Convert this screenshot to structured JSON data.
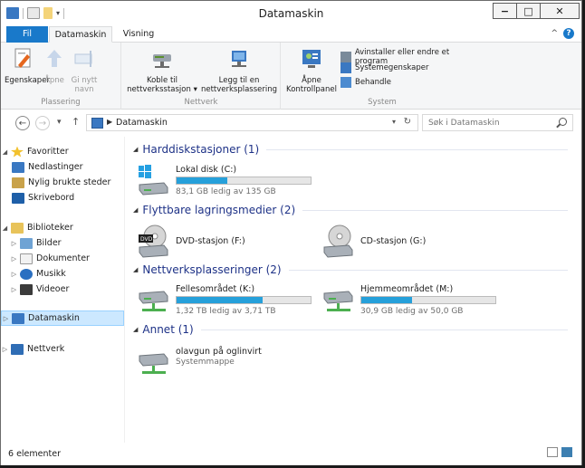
{
  "window": {
    "title": "Datamaskin"
  },
  "title_buttons": {
    "minimize": "−",
    "maximize": "□",
    "close": "✕"
  },
  "tabs": {
    "file": "Fil",
    "computer": "Datamaskin",
    "view": "Visning"
  },
  "ribbon": {
    "location": {
      "label": "Plassering",
      "properties": "Egenskaper",
      "open": "Åpne",
      "rename_1": "Gi nytt",
      "rename_2": "navn"
    },
    "network": {
      "label": "Nettverk",
      "map_drive_1": "Koble til",
      "map_drive_2": "nettverksstasjon ▾",
      "add_location_1": "Legg til en",
      "add_location_2": "nettverksplassering"
    },
    "system": {
      "label": "System",
      "control_panel_1": "Åpne",
      "control_panel_2": "Kontrollpanel",
      "uninstall": "Avinstaller eller endre et program",
      "sysprops": "Systemegenskaper",
      "manage": "Behandle"
    }
  },
  "address": {
    "path": "Datamaskin",
    "search_placeholder": "Søk i Datamaskin"
  },
  "navpane": {
    "favorites": "Favoritter",
    "downloads": "Nedlastinger",
    "recent": "Nylig brukte steder",
    "desktop": "Skrivebord",
    "libraries": "Biblioteker",
    "pictures": "Bilder",
    "documents": "Dokumenter",
    "music": "Musikk",
    "videos": "Videoer",
    "computer": "Datamaskin",
    "network": "Nettverk"
  },
  "groups": {
    "hdd": "Harddiskstasjoner (1)",
    "removable": "Flyttbare lagringsmedier (2)",
    "network": "Nettverksplasseringer (2)",
    "other": "Annet (1)"
  },
  "drives": {
    "c": {
      "name": "Lokal disk (C:)",
      "free": "83,1 GB ledig av 135 GB",
      "used_fraction": 0.38
    },
    "f": {
      "name": "DVD-stasjon (F:)"
    },
    "g": {
      "name": "CD-stasjon (G:)"
    },
    "k": {
      "name": "Fellesområdet (K:)",
      "free": "1,32 TB ledig av 3,71 TB",
      "used_fraction": 0.64
    },
    "m": {
      "name": "Hjemmeområdet (M:)",
      "free": "30,9 GB ledig av 50,0 GB",
      "used_fraction": 0.38
    },
    "olav": {
      "name": "olavgun på oglinvirt",
      "type": "Systemmappe"
    }
  },
  "status": {
    "count": "6 elementer"
  },
  "colors": {
    "accent": "#1979ca",
    "bar": "#26a0da",
    "group_title": "#1e3287"
  }
}
